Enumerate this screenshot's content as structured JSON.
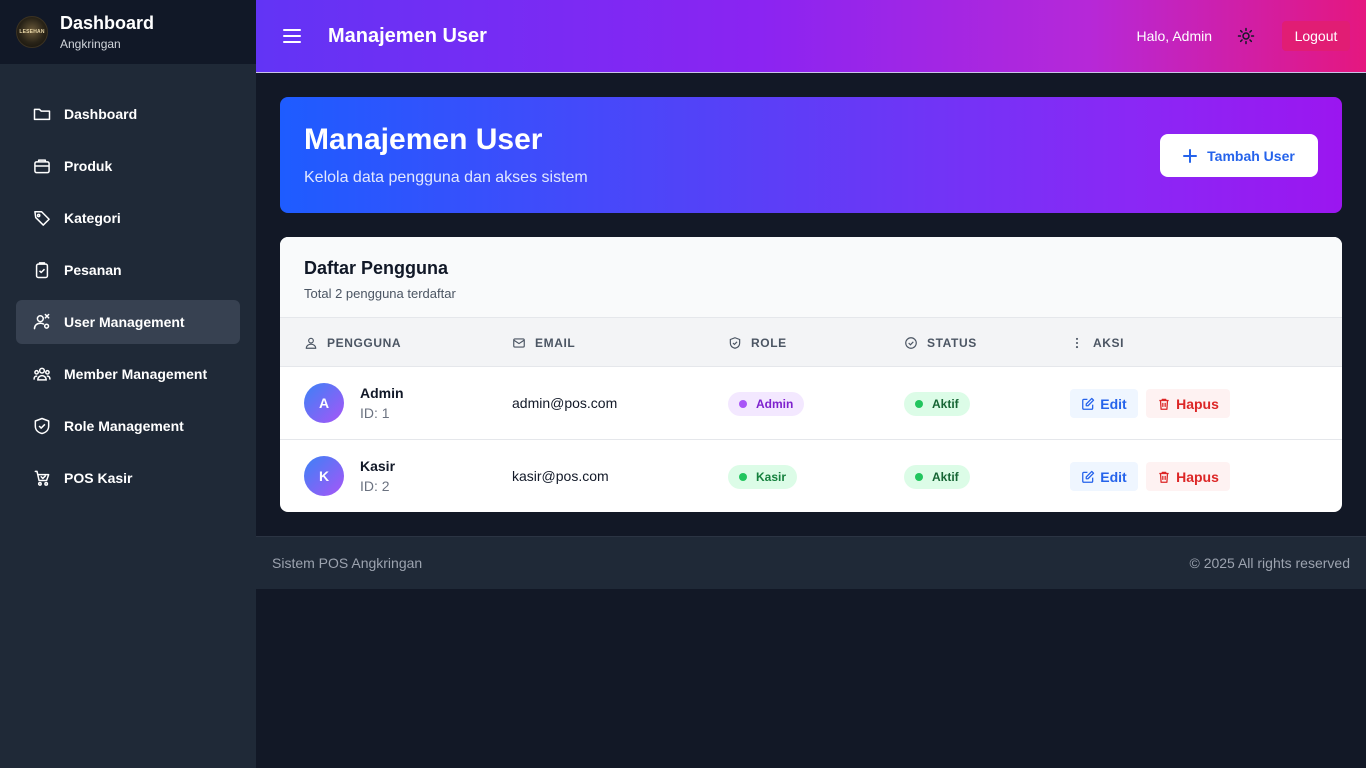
{
  "brand": {
    "title": "Dashboard",
    "subtitle": "Angkringan",
    "logo_text": "LESEHAN"
  },
  "sidebar": {
    "items": [
      {
        "label": "Dashboard",
        "icon": "folder-icon",
        "active": false
      },
      {
        "label": "Produk",
        "icon": "box-icon",
        "active": false
      },
      {
        "label": "Kategori",
        "icon": "tag-icon",
        "active": false
      },
      {
        "label": "Pesanan",
        "icon": "clipboard-check-icon",
        "active": false
      },
      {
        "label": "User Management",
        "icon": "user-settings-icon",
        "active": true
      },
      {
        "label": "Member Management",
        "icon": "users-group-icon",
        "active": false
      },
      {
        "label": "Role Management",
        "icon": "shield-check-icon",
        "active": false
      },
      {
        "label": "POS Kasir",
        "icon": "cart-icon",
        "active": false
      }
    ]
  },
  "header": {
    "title": "Manajemen User",
    "greeting": "Halo, Admin",
    "logout_label": "Logout",
    "theme_icon": "sun-icon"
  },
  "hero": {
    "title": "Manajemen User",
    "subtitle": "Kelola data pengguna dan akses sistem",
    "add_button_label": "Tambah User"
  },
  "table": {
    "title": "Daftar Pengguna",
    "subtitle": "Total 2 pengguna terdaftar",
    "columns": [
      "PENGGUNA",
      "EMAIL",
      "ROLE",
      "STATUS",
      "AKSI"
    ],
    "rows": [
      {
        "initial": "A",
        "name": "Admin",
        "id": "ID: 1",
        "email": "admin@pos.com",
        "role": "Admin",
        "status": "Aktif",
        "edit": "Edit",
        "delete": "Hapus"
      },
      {
        "initial": "K",
        "name": "Kasir",
        "id": "ID: 2",
        "email": "kasir@pos.com",
        "role": "Kasir",
        "status": "Aktif",
        "edit": "Edit",
        "delete": "Hapus"
      }
    ]
  },
  "footer": {
    "left": "Sistem POS Angkringan",
    "right": "© 2025 All rights reserved"
  },
  "colors": {
    "sidebar_bg": "#1f2937",
    "page_bg": "#121826",
    "accent_blue": "#2563eb",
    "danger": "#dc2626",
    "logout_bg": "#e11d74"
  }
}
